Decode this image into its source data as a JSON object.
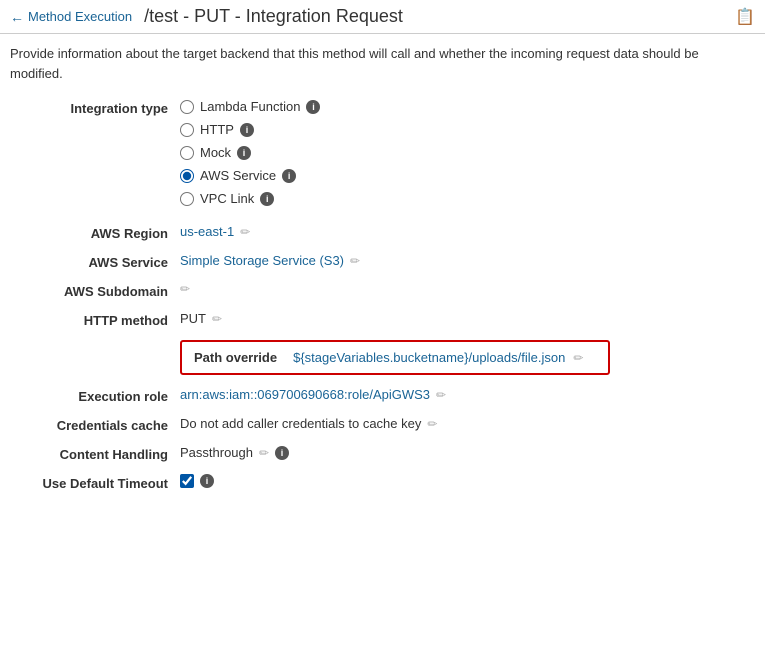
{
  "header": {
    "back_label": "Method Execution",
    "title": "/test - PUT - Integration Request",
    "copy_icon": "📋"
  },
  "description": "Provide information about the target backend that this method will call and whether the incoming request data should be modified.",
  "form": {
    "integration_type": {
      "label": "Integration type",
      "options": [
        {
          "id": "lambda",
          "label": "Lambda Function",
          "selected": false
        },
        {
          "id": "http",
          "label": "HTTP",
          "selected": false
        },
        {
          "id": "mock",
          "label": "Mock",
          "selected": false
        },
        {
          "id": "aws",
          "label": "AWS Service",
          "selected": true
        },
        {
          "id": "vpc",
          "label": "VPC Link",
          "selected": false
        }
      ]
    },
    "aws_region": {
      "label": "AWS Region",
      "value": "us-east-1"
    },
    "aws_service": {
      "label": "AWS Service",
      "value": "Simple Storage Service (S3)"
    },
    "aws_subdomain": {
      "label": "AWS Subdomain",
      "value": ""
    },
    "http_method": {
      "label": "HTTP method",
      "value": "PUT"
    },
    "path_override": {
      "label": "Path override",
      "value": "${stageVariables.bucketname}/uploads/file.json"
    },
    "execution_role": {
      "label": "Execution role",
      "value": "arn:aws:iam::069700690668:role/ApiGWS3"
    },
    "credentials_cache": {
      "label": "Credentials cache",
      "value": "Do not add caller credentials to cache key"
    },
    "content_handling": {
      "label": "Content Handling",
      "value": "Passthrough"
    },
    "use_default_timeout": {
      "label": "Use Default Timeout",
      "checked": true
    }
  }
}
